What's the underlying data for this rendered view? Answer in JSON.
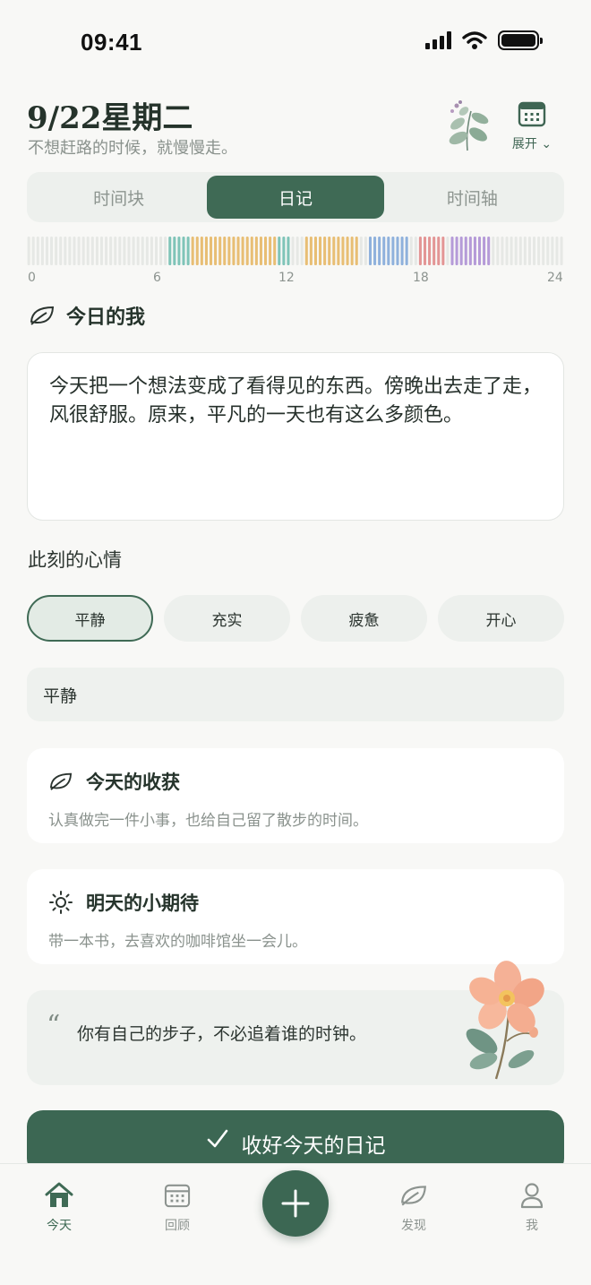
{
  "status_bar": {
    "time": "09:41"
  },
  "header": {
    "date": "9/22星期二",
    "subtitle": "不想赶路的时候，就慢慢走。",
    "calendar_label": "展开"
  },
  "tabs": [
    {
      "label": "时间块",
      "active": false
    },
    {
      "label": "日记",
      "active": true
    },
    {
      "label": "时间轴",
      "active": false
    }
  ],
  "timeline": {
    "tick_labels": [
      "0",
      "6",
      "12",
      "18",
      "24"
    ],
    "colors": {
      "empty": "#e6e8e5",
      "teal": "#7fc4b8",
      "amber": "#e8be74",
      "blue": "#8fb1dc",
      "red": "#e39595",
      "purple": "#b59bd8"
    }
  },
  "today_section": {
    "title": "今日的我"
  },
  "diary": {
    "text": "今天把一个想法变成了看得见的东西。傍晚出去走了走，风很舒服。原来，平凡的一天也有这么多颜色。"
  },
  "mood": {
    "label": "此刻的心情",
    "options": [
      {
        "label": "平静",
        "selected": true
      },
      {
        "label": "充实",
        "selected": false
      },
      {
        "label": "疲惫",
        "selected": false
      },
      {
        "label": "开心",
        "selected": false
      }
    ],
    "input_value": "平静"
  },
  "gains_card": {
    "title": "今天的收获",
    "text": "认真做完一件小事，也给自己留了散步的时间。"
  },
  "tomorrow_card": {
    "title": "明天的小期待",
    "text": "带一本书，去喜欢的咖啡馆坐一会儿。"
  },
  "quote": {
    "mark": "“",
    "text": "你有自己的步子，不必追着谁的时钟。"
  },
  "save_button": {
    "label": "收好今天的日记"
  },
  "bottom_nav": [
    {
      "label": "今天",
      "icon": "home-icon",
      "active": true
    },
    {
      "label": "回顾",
      "icon": "calendar-icon",
      "active": false
    },
    {
      "label": "发现",
      "icon": "leaf-icon",
      "active": false
    },
    {
      "label": "我",
      "icon": "user-icon",
      "active": false
    }
  ],
  "theme": {
    "accent": "#3f6a55",
    "background": "#f8f8f6"
  }
}
